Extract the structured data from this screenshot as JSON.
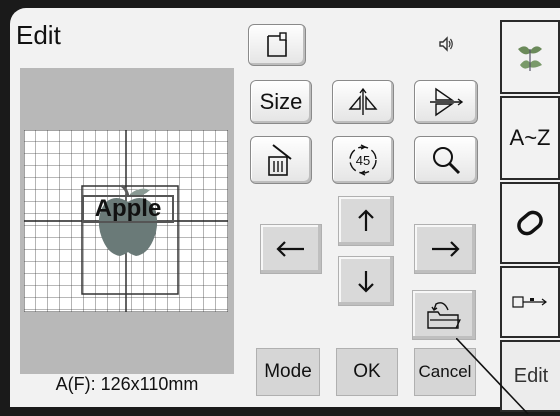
{
  "screen": {
    "title": "Edit"
  },
  "preview": {
    "pattern_label": "Apple",
    "size_readout": "A(F): 126x110mm"
  },
  "toolbar": {
    "size_label": "Size",
    "rotate_label": "45"
  },
  "bottom_bar": {
    "mode_label": "Mode",
    "ok_label": "OK",
    "cancel_label": "Cancel"
  },
  "side_tabs": {
    "alpha_label": "A~Z",
    "edit_label": "Edit"
  },
  "colors": {
    "apple": "#6a7a78",
    "frame": "#1a1a1a",
    "screen_bg": "#f2f2f2",
    "preview_bg": "#b8b8b8"
  }
}
